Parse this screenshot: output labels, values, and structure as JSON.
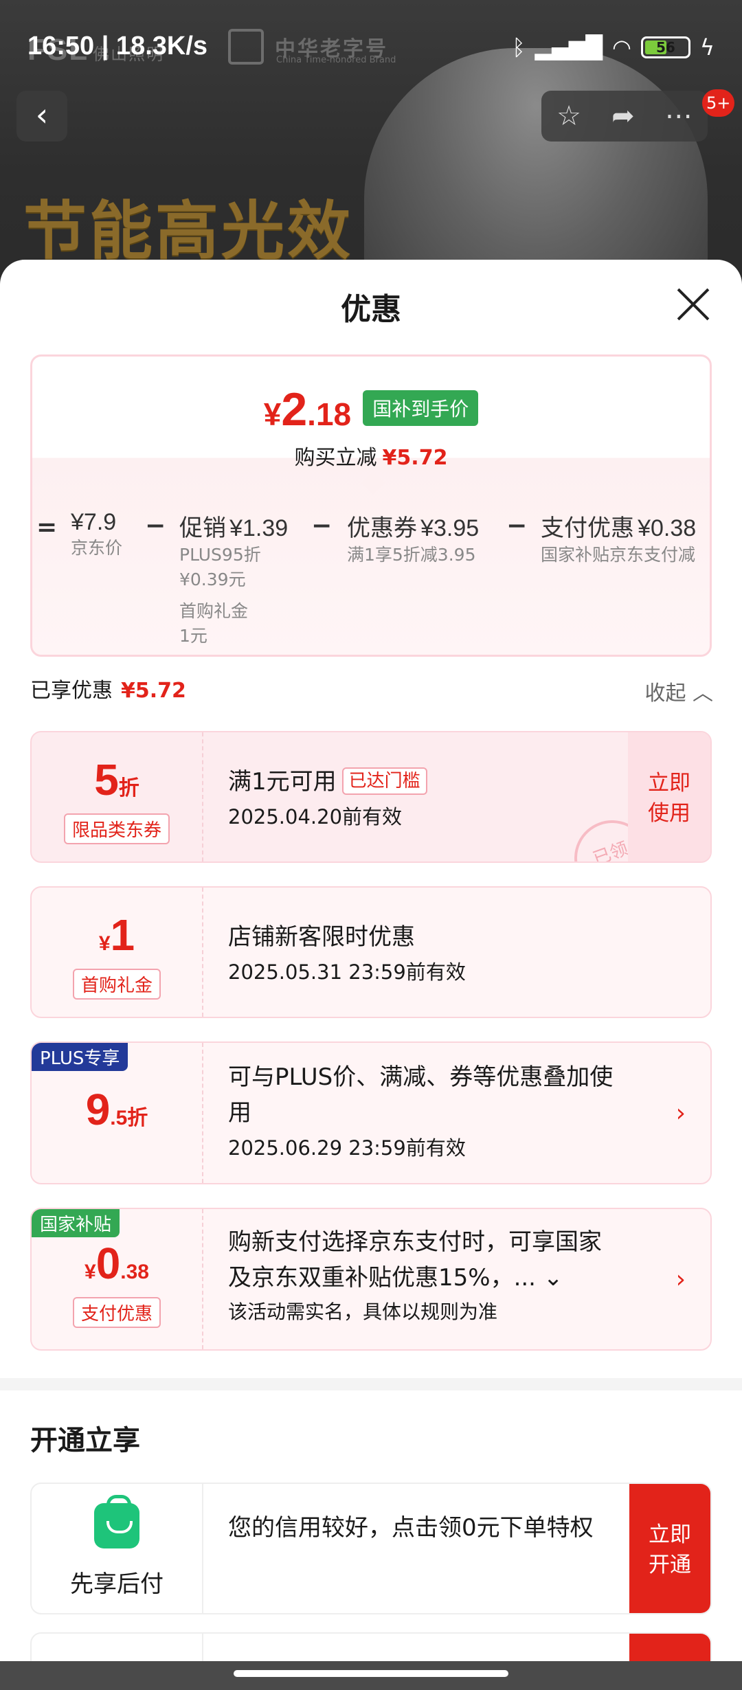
{
  "status_bar": {
    "time": "16:50 | 18.3K/s",
    "battery_level": "56",
    "battery_fraction": 0.56
  },
  "background_page": {
    "brand_logo": "FSL",
    "brand_logo_sub": "佛山照明",
    "brand_cn": "中华老字号",
    "brand_en": "China Time-honored Brand",
    "hero_text": "节能高光效",
    "badge_count": "5+"
  },
  "sheet": {
    "title": "优惠",
    "summary": {
      "currency": "¥",
      "final_int": "2",
      "final_dec": ".18",
      "final_tag": "国补到手价",
      "reduce_label": "购买立减",
      "reduce_amount": "¥5.72",
      "equals": "=",
      "minus": "−",
      "items": [
        {
          "value": "¥7.9",
          "label": "",
          "subs": [
            "京东价"
          ]
        },
        {
          "value": "¥1.39",
          "label": "促销",
          "subs": [
            "PLUS95折",
            "¥0.39元",
            "",
            "首购礼金",
            "1元"
          ]
        },
        {
          "value": "¥3.95",
          "label": "优惠券",
          "subs": [
            "满1享5折减3.95"
          ]
        },
        {
          "value": "¥0.38",
          "label": "支付优惠",
          "subs": [
            "国家补贴京东支付减"
          ]
        }
      ]
    },
    "saved": {
      "label": "已享优惠",
      "amount": "¥5.72",
      "collapse_label": "收起"
    },
    "coupons": [
      {
        "big_num": "5",
        "big_suffix": "折",
        "tag": "限品类东券",
        "title": "满1元可用",
        "reach_tag": "已达门槛",
        "date": "2025.04.20前有效",
        "action": "立即\n使用",
        "stamp": "已领"
      },
      {
        "big_prefix": "¥",
        "big_num": "1",
        "tag": "首购礼金",
        "title": "店铺新客限时优惠",
        "date": "2025.05.31 23:59前有效"
      },
      {
        "corner": "PLUS专享",
        "big_num": "9",
        "big_suffix": ".5折",
        "title": "可与PLUS价、满减、券等优惠叠加使用",
        "date": "2025.06.29 23:59前有效"
      },
      {
        "corner": "国家补贴",
        "big_prefix": "¥",
        "big_num": "0",
        "big_suffix": ".38",
        "tag": "支付优惠",
        "title": "购新支付选择京东支付时，可享国家及京东双重补贴优惠15%，...",
        "date": "该活动需实名，具体以规则为准"
      }
    ],
    "open_section": {
      "title": "开通立享",
      "service_name": "先享后付",
      "service_text": "您的信用较好，点击领0元下单特权",
      "service_action": "立即\n开通"
    }
  }
}
